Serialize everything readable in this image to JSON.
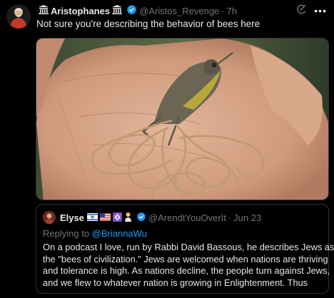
{
  "tweet": {
    "author_name": "Aristophanes",
    "author_handle": "@Aristos_Revenge",
    "time": "7h",
    "separator": "·",
    "more_label": "•••",
    "text": "Not sure you're describing the behavior of bees here"
  },
  "quote": {
    "author_name": "Elyse",
    "author_handle": "@ArendtYouOverIt",
    "date": "Jun 23",
    "separator": "·",
    "replying_prefix": "Replying to ",
    "replying_mention": "@BriannaWu",
    "body_lines": [
      "On a podcast I love, run by Rabbi David Bassous, he describes Jews as",
      "the \"bees of civilization.\" Jews are welcomed when nations are thriving",
      "and tolerance is high. As nations decline, the people turn against Jews,",
      "and we flew to whatever nation is growing in Enlightenment. Thus"
    ]
  },
  "colors": {
    "background": "#000000",
    "text": "#e7e9ea",
    "muted": "#71767b",
    "accent": "#1d9bf0",
    "border": "#2f3336"
  },
  "icons": [
    "columns-icon",
    "verified-badge-icon",
    "grok-icon",
    "more-icon",
    "flag-israel-icon",
    "flag-usa-icon",
    "star-of-david-icon",
    "person-icon"
  ]
}
